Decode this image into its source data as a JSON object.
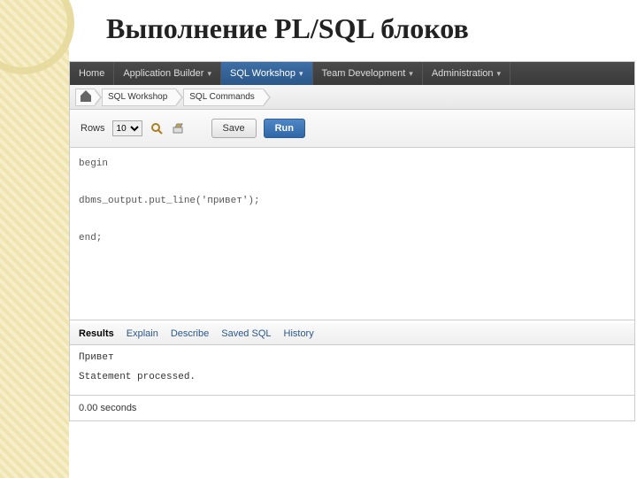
{
  "slide": {
    "title": "Выполнение PL/SQL блоков"
  },
  "topnav": {
    "items": [
      {
        "label": "Home"
      },
      {
        "label": "Application Builder"
      },
      {
        "label": "SQL Workshop"
      },
      {
        "label": "Team Development"
      },
      {
        "label": "Administration"
      }
    ]
  },
  "breadcrumb": {
    "items": [
      {
        "label": "SQL Workshop"
      },
      {
        "label": "SQL Commands"
      }
    ]
  },
  "toolbar": {
    "rows_label": "Rows",
    "rows_value": "10",
    "save_label": "Save",
    "run_label": "Run"
  },
  "code": "begin\n\ndbms_output.put_line('привет');\n\nend;",
  "result_tabs": {
    "items": [
      {
        "label": "Results"
      },
      {
        "label": "Explain"
      },
      {
        "label": "Describe"
      },
      {
        "label": "Saved SQL"
      },
      {
        "label": "History"
      }
    ]
  },
  "output": {
    "line1": "Привет",
    "line2": "Statement processed."
  },
  "timing": "0.00 seconds"
}
